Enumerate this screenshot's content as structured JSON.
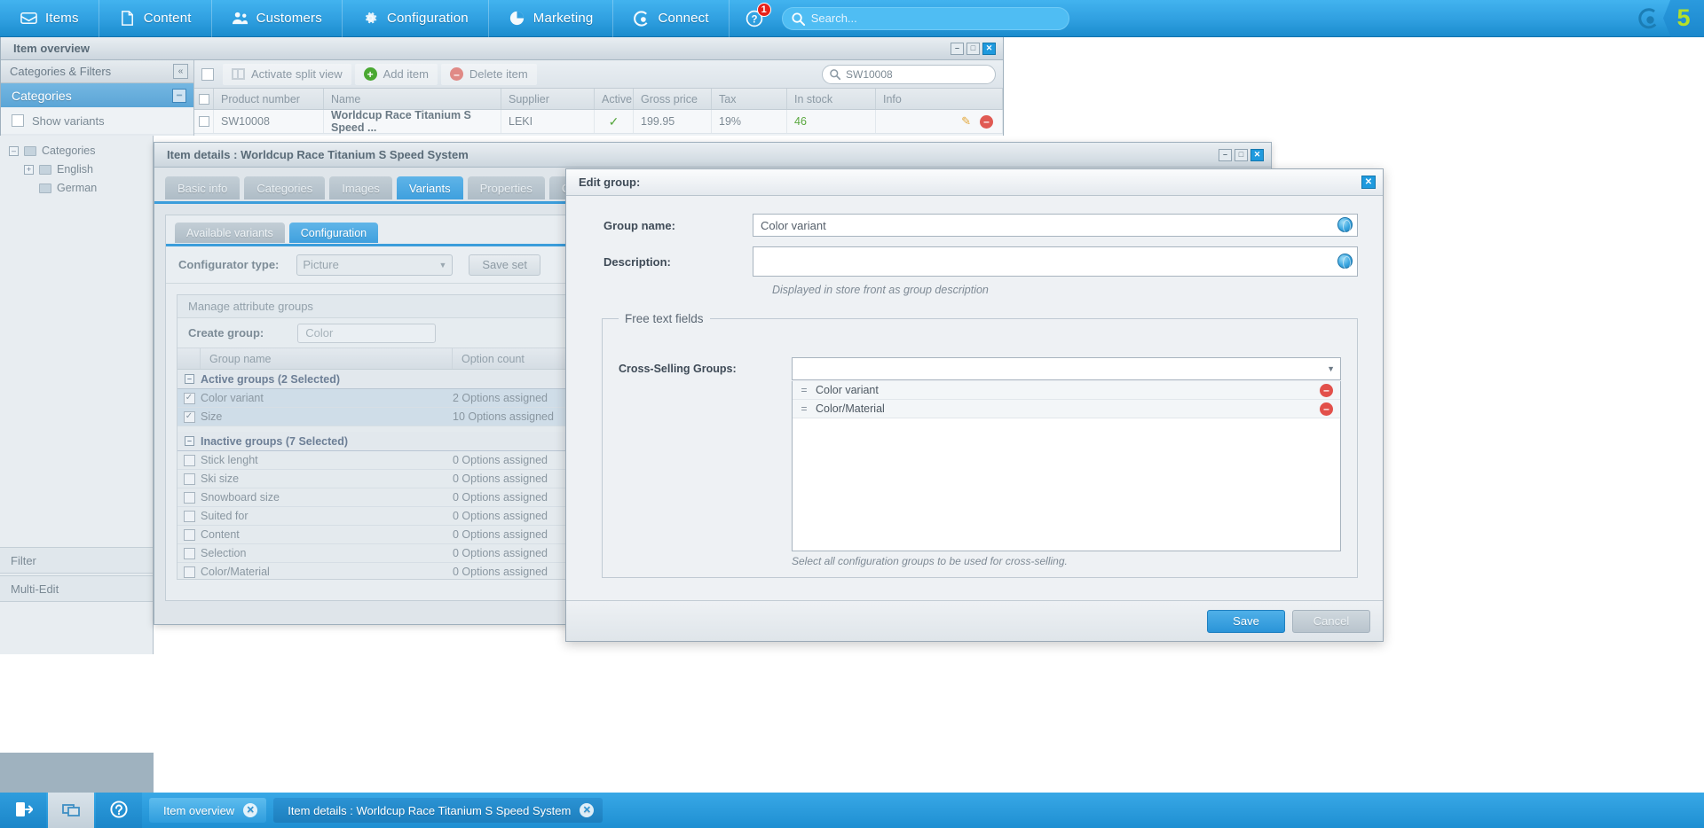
{
  "topnav": {
    "items": [
      {
        "label": "Items",
        "icon": "inbox-icon"
      },
      {
        "label": "Content",
        "icon": "document-icon"
      },
      {
        "label": "Customers",
        "icon": "users-icon"
      },
      {
        "label": "Configuration",
        "icon": "gear-icon"
      },
      {
        "label": "Marketing",
        "icon": "pie-chart-icon"
      },
      {
        "label": "Connect",
        "icon": "connect-icon"
      }
    ],
    "help": {
      "icon": "help-icon",
      "badge": "1"
    },
    "search": {
      "placeholder": "Search...",
      "value": "",
      "icon": "search-icon"
    },
    "brand": {
      "mark": "shopware-logo-icon",
      "version": "5"
    }
  },
  "overview_window": {
    "title": "Item overview",
    "buttons": {
      "minimize": "–",
      "maximize": "□",
      "close": "✕"
    },
    "sidebar": {
      "header": "Categories & Filters",
      "collapse_icon": "«",
      "categories_header": "Categories",
      "minus_icon": "–",
      "show_variants": "Show variants",
      "tree": [
        {
          "label": "Categories",
          "level": 0,
          "icon": "folder-icon"
        },
        {
          "label": "English",
          "level": 1,
          "icon": "folder-icon"
        },
        {
          "label": "German",
          "level": 2,
          "icon": "folder-icon"
        }
      ],
      "filter": "Filter",
      "multi_edit": "Multi-Edit"
    },
    "toolbar": {
      "split_view": "Activate split view",
      "add_item": "Add item",
      "delete_item": "Delete item",
      "search_value": "SW10008",
      "search_icon": "search-icon"
    },
    "grid": {
      "columns": [
        "Product number",
        "Name",
        "Supplier",
        "Active",
        "Gross price",
        "Tax",
        "In stock",
        "Info"
      ],
      "rows": [
        {
          "product_number": "SW10008",
          "name": "Worldcup Race Titanium S Speed ...",
          "supplier": "LEKI",
          "active": "✓",
          "gross_price": "199.95",
          "tax": "19%",
          "in_stock": "46",
          "info": "",
          "edit_icon": "pencil-icon",
          "delete_icon": "remove-icon"
        }
      ]
    }
  },
  "details_window": {
    "title": "Item details : Worldcup Race Titanium S Speed System",
    "buttons": {
      "minimize": "–",
      "maximize": "□",
      "close": "✕"
    },
    "tabs": [
      {
        "label": "Basic info",
        "active": false
      },
      {
        "label": "Categories",
        "active": false
      },
      {
        "label": "Images",
        "active": false
      },
      {
        "label": "Variants",
        "active": true
      },
      {
        "label": "Properties",
        "active": false
      },
      {
        "label": "Cross-selling",
        "active": false
      }
    ],
    "subtabs": [
      {
        "label": "Available variants",
        "active": false
      },
      {
        "label": "Configuration",
        "active": true
      }
    ],
    "configurator": {
      "label": "Configurator type:",
      "value": "Picture",
      "save_set": "Save set"
    },
    "manage_groups": {
      "header": "Manage attribute groups",
      "create_label": "Create group:",
      "create_placeholder": "Color",
      "columns": [
        "Group name",
        "Option count"
      ],
      "sections": [
        {
          "title": "Active groups (2 Selected)",
          "rows": [
            {
              "name": "Color variant",
              "count": "2 Options assigned",
              "checked": true
            },
            {
              "name": "Size",
              "count": "10 Options assigned",
              "checked": true
            }
          ]
        },
        {
          "title": "Inactive groups (7 Selected)",
          "rows": [
            {
              "name": "Stick lenght",
              "count": "0 Options assigned",
              "checked": false
            },
            {
              "name": "Ski size",
              "count": "0 Options assigned",
              "checked": false
            },
            {
              "name": "Snowboard size",
              "count": "0 Options assigned",
              "checked": false
            },
            {
              "name": "Suited for",
              "count": "0 Options assigned",
              "checked": false
            },
            {
              "name": "Content",
              "count": "0 Options assigned",
              "checked": false
            },
            {
              "name": "Selection",
              "count": "0 Options assigned",
              "checked": false
            },
            {
              "name": "Color/Material",
              "count": "0 Options assigned",
              "checked": false
            }
          ]
        }
      ]
    }
  },
  "edit_group": {
    "title": "Edit group:",
    "close_icon": "✕",
    "group_name": {
      "label": "Group name:",
      "value": "Color variant",
      "translate_icon": "globe-icon"
    },
    "description": {
      "label": "Description:",
      "value": "",
      "translate_icon": "globe-icon",
      "hint": "Displayed in store front as group description"
    },
    "free_text_fields": {
      "legend": "Free text fields",
      "cross_selling": {
        "label": "Cross-Selling Groups:",
        "value": "",
        "arrow_icon": "chevron-down-icon",
        "hint": "Select all configuration groups to be used for cross-selling.",
        "items": [
          {
            "label": "Color variant",
            "drag_icon": "drag-handle-icon",
            "remove_icon": "remove-icon"
          },
          {
            "label": "Color/Material",
            "drag_icon": "drag-handle-icon",
            "remove_icon": "remove-icon"
          }
        ]
      }
    },
    "footer": {
      "save": "Save",
      "cancel": "Cancel"
    }
  },
  "taskbar": {
    "buttons": [
      {
        "icon": "logout-icon"
      },
      {
        "icon": "windows-icon"
      },
      {
        "icon": "help-circle-icon"
      }
    ],
    "tasks": [
      {
        "label": "Item overview",
        "active": false,
        "close_icon": "✕"
      },
      {
        "label": "Item details : Worldcup Race Titanium S Speed System",
        "active": true,
        "close_icon": "✕"
      }
    ]
  },
  "colors": {
    "accent": "#2f9fe0",
    "brand_green": "#b6e028",
    "danger": "#e2504a",
    "success": "#55a63c"
  }
}
